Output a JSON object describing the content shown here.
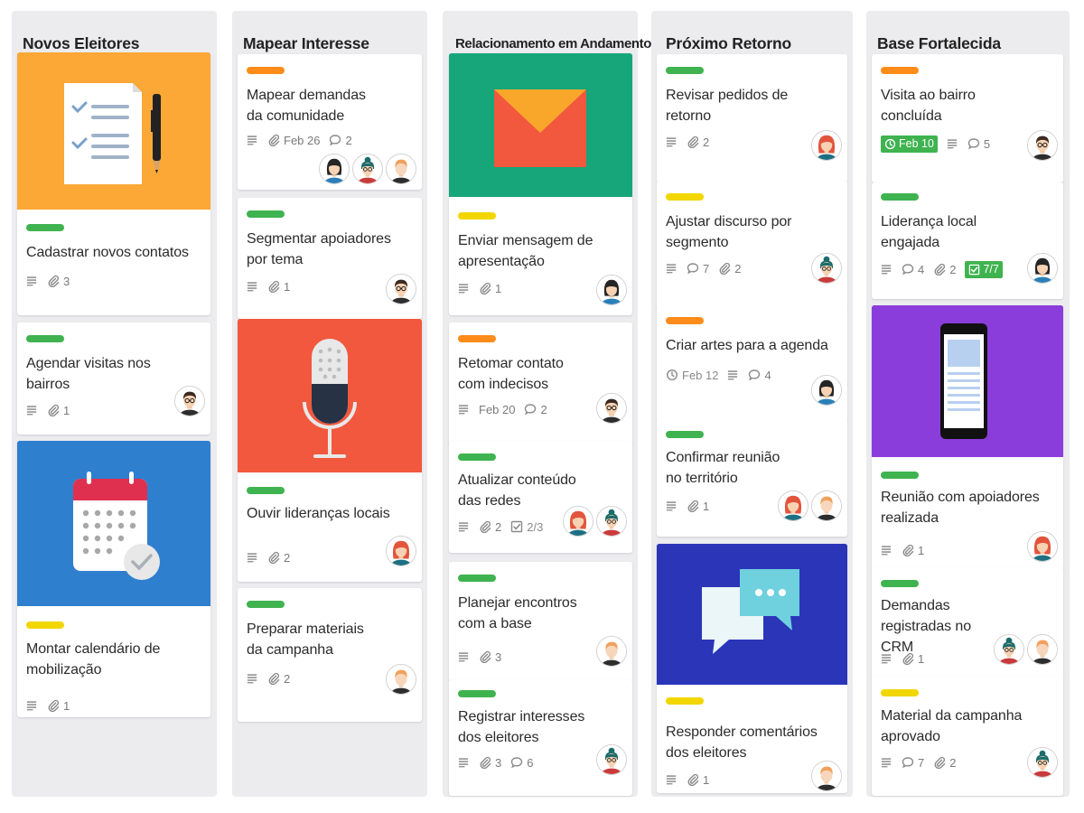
{
  "board": {
    "columns": [
      {
        "title": "Novos Eleitores",
        "cards": [
          {
            "title": "Cadastrar novos contatos",
            "attachments": "3"
          },
          {
            "title": "Agendar visitas nos bairros",
            "attachments": "1"
          },
          {
            "title": "Montar calendário de mobilização",
            "attachments": "1"
          }
        ]
      },
      {
        "title": "Mapear Interesse",
        "cards": [
          {
            "title": "Mapear demandas da comunidade",
            "due": "Feb 26",
            "comments": "2"
          },
          {
            "title": "Segmentar apoiadores por tema",
            "attachments": "1"
          },
          {
            "title": "Ouvir lideranças locais",
            "attachments": "2"
          },
          {
            "title": "Preparar materiais da campanha",
            "attachments": "2"
          }
        ]
      },
      {
        "title": "Relacionamento em Andamento",
        "cards": [
          {
            "title": "Enviar mensagem de apresentação",
            "attachments": "1"
          },
          {
            "title": "Retomar contato com indecisos",
            "due": "Feb 20",
            "comments": "2"
          },
          {
            "title": "Atualizar conteúdo das redes",
            "attachments": "2",
            "checklist": "2/3"
          },
          {
            "title": "Planejar encontros com a base",
            "attachments": "3"
          },
          {
            "title": "Registrar interesses dos eleitores",
            "attachments": "3",
            "comments": "6"
          }
        ]
      },
      {
        "title": "Próximo Retorno",
        "cards": [
          {
            "title": "Revisar pedidos de retorno",
            "attachments": "2"
          },
          {
            "title": "Ajustar discurso por segmento",
            "comments": "7",
            "attachments": "2"
          },
          {
            "title": "Criar artes para a agenda",
            "due": "Feb 12",
            "comments": "4"
          },
          {
            "title": "Confirmar reunião no território",
            "attachments": "1"
          },
          {
            "title": "Responder comentários dos eleitores",
            "attachments": "1"
          }
        ]
      },
      {
        "title": "Base Fortalecida",
        "cards": [
          {
            "title": "Visita ao bairro concluída",
            "due": "Feb 10",
            "comments": "5"
          },
          {
            "title": "Liderança local engajada",
            "comments": "4",
            "attachments": "2",
            "checklist": "7/7"
          },
          {
            "title": "Reunião com apoiadores realizada",
            "attachments": "1"
          },
          {
            "title": "Demandas registradas no CRM",
            "attachments": "1"
          },
          {
            "title": "Material da campanha aprovado",
            "comments": "7",
            "attachments": "2"
          }
        ]
      }
    ]
  },
  "colors": {
    "green_label": "#3fb34f",
    "orange_label": "#ff8c1a",
    "yellow_label": "#f2d600",
    "column_bg": "#ececef"
  },
  "icons": {
    "description": "description-icon",
    "attachment": "paperclip-icon",
    "comment": "comment-icon",
    "due": "clock-icon",
    "checklist": "checklist-icon"
  }
}
